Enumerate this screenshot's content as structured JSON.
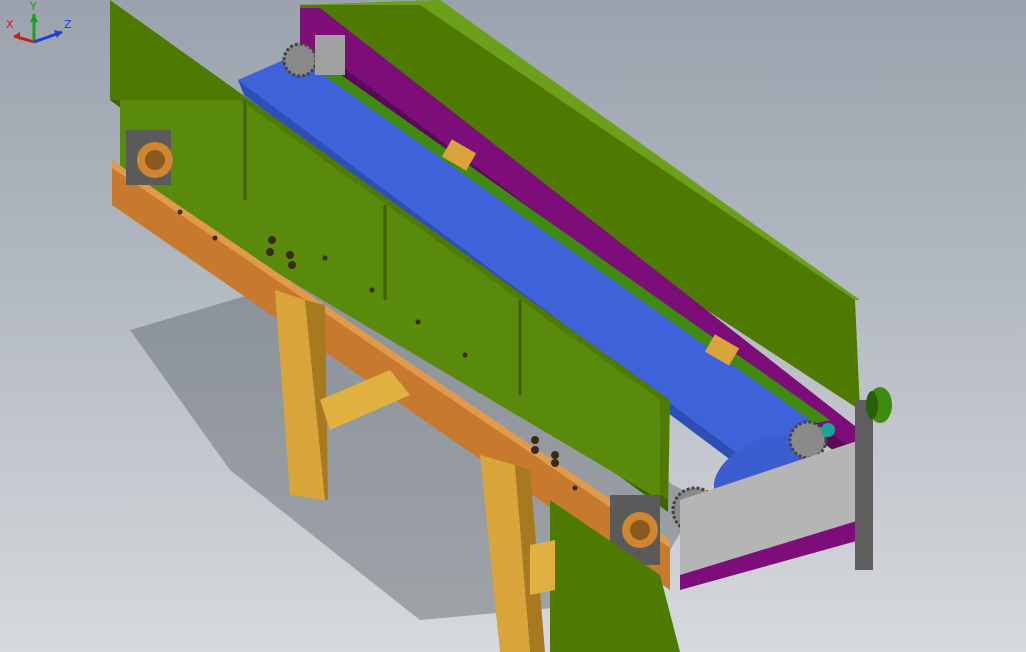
{
  "viewport": {
    "background_top": "#9aa2ad",
    "background_bottom": "#d6d9dd",
    "model": "belt-conveyor-assembly"
  },
  "colors": {
    "guard_green": "#4e7a02",
    "guard_green_light": "#5f9010",
    "belt_blue": "#3d62d9",
    "frame_orange": "#c77a2e",
    "leg_yellow": "#d9a53a",
    "side_plate_purple": "#7d0d78",
    "roller_grey": "#b5b5b5",
    "shaft_teal": "#1fa098"
  },
  "triad": {
    "x_label": "X",
    "y_label": "Y",
    "z_label": "Z",
    "x_color": "#d21a1a",
    "y_color": "#17a317",
    "z_color": "#1e3fd8"
  }
}
